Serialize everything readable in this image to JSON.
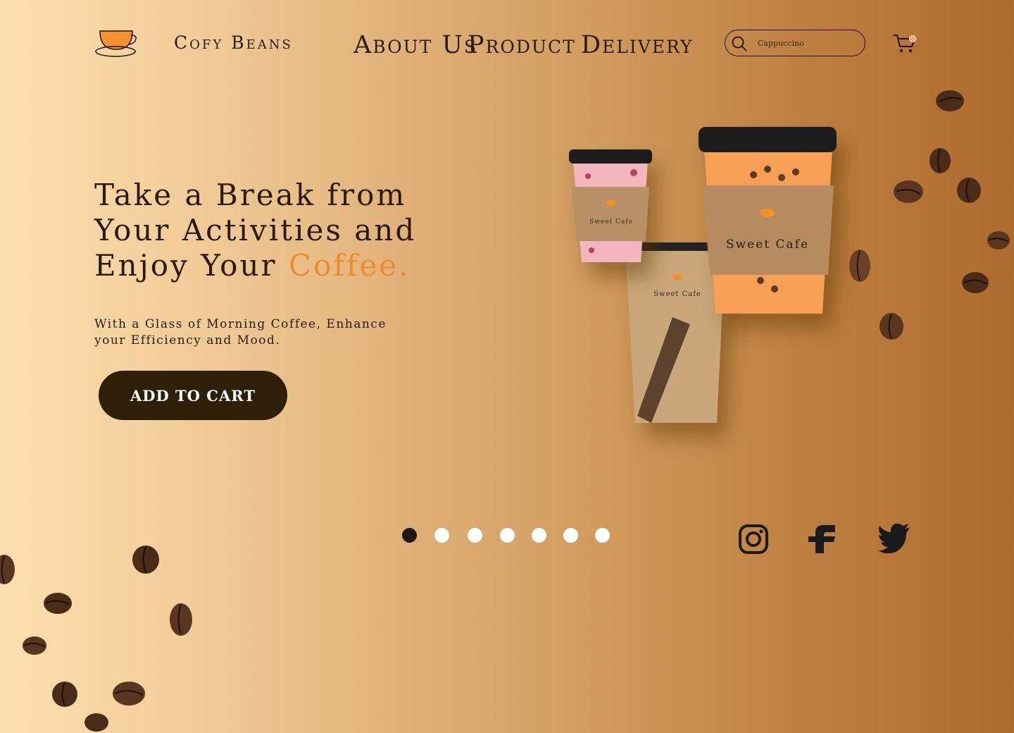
{
  "header": {
    "brand": "Cofy Beans",
    "nav": [
      {
        "label": "About Us"
      },
      {
        "label": "Product"
      },
      {
        "label": "Delivery"
      }
    ],
    "search": {
      "placeholder": "Cappuccino",
      "icon": "search-icon"
    },
    "cart": {
      "icon": "cart-icon"
    }
  },
  "hero": {
    "headline_part1": "Take a Break from Your Activities and Enjoy Your ",
    "headline_accent": "Coffee.",
    "subtitle": "With a Glass of Morning Coffee, Enhance your Efficiency and Mood.",
    "cta_label": "ADD TO CART",
    "cup_brand": "Sweet Cafe"
  },
  "carousel": {
    "total": 7,
    "active_index": 0
  },
  "social": [
    {
      "icon": "instagram-icon"
    },
    {
      "icon": "facebook-icon"
    },
    {
      "icon": "twitter-icon"
    }
  ],
  "colors": {
    "accent": "#f08a2c",
    "button": "#2e1f08",
    "text": "#2a1a0a",
    "bg_left": "#fde0b0",
    "bg_right": "#ad6b2e"
  }
}
